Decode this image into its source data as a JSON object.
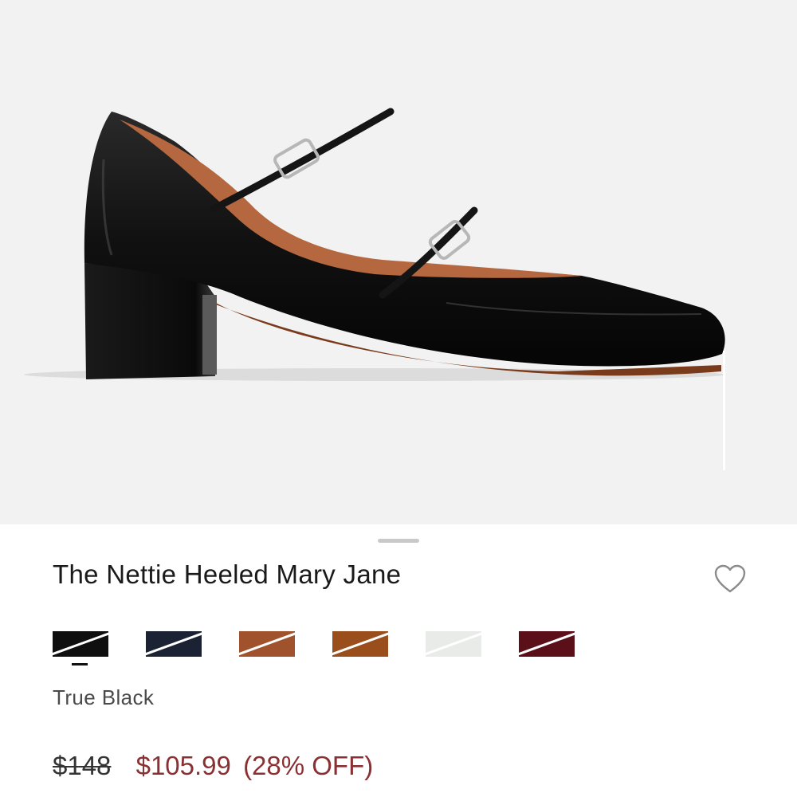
{
  "product": {
    "title": "The Nettie Heeled Mary Jane",
    "selected_color": "True Black",
    "price": {
      "original": "$148",
      "sale": "$105.99",
      "discount": "(28% OFF)"
    }
  },
  "swatches": [
    {
      "name": "True Black",
      "color": "#0f0f0f",
      "selected": true
    },
    {
      "name": "Navy",
      "color": "#1b2233",
      "selected": false
    },
    {
      "name": "Cognac",
      "color": "#a0522d",
      "selected": false
    },
    {
      "name": "Cognac Suede",
      "color": "#9a4e1c",
      "selected": false
    },
    {
      "name": "White",
      "color": "#e9ebe8",
      "selected": false
    },
    {
      "name": "Burgundy",
      "color": "#5a0f19",
      "selected": false
    }
  ],
  "colors": {
    "accent_price": "#8a3033",
    "hero_background": "#f2f2f2"
  },
  "icons": {
    "favorite": "heart-outline-icon"
  }
}
